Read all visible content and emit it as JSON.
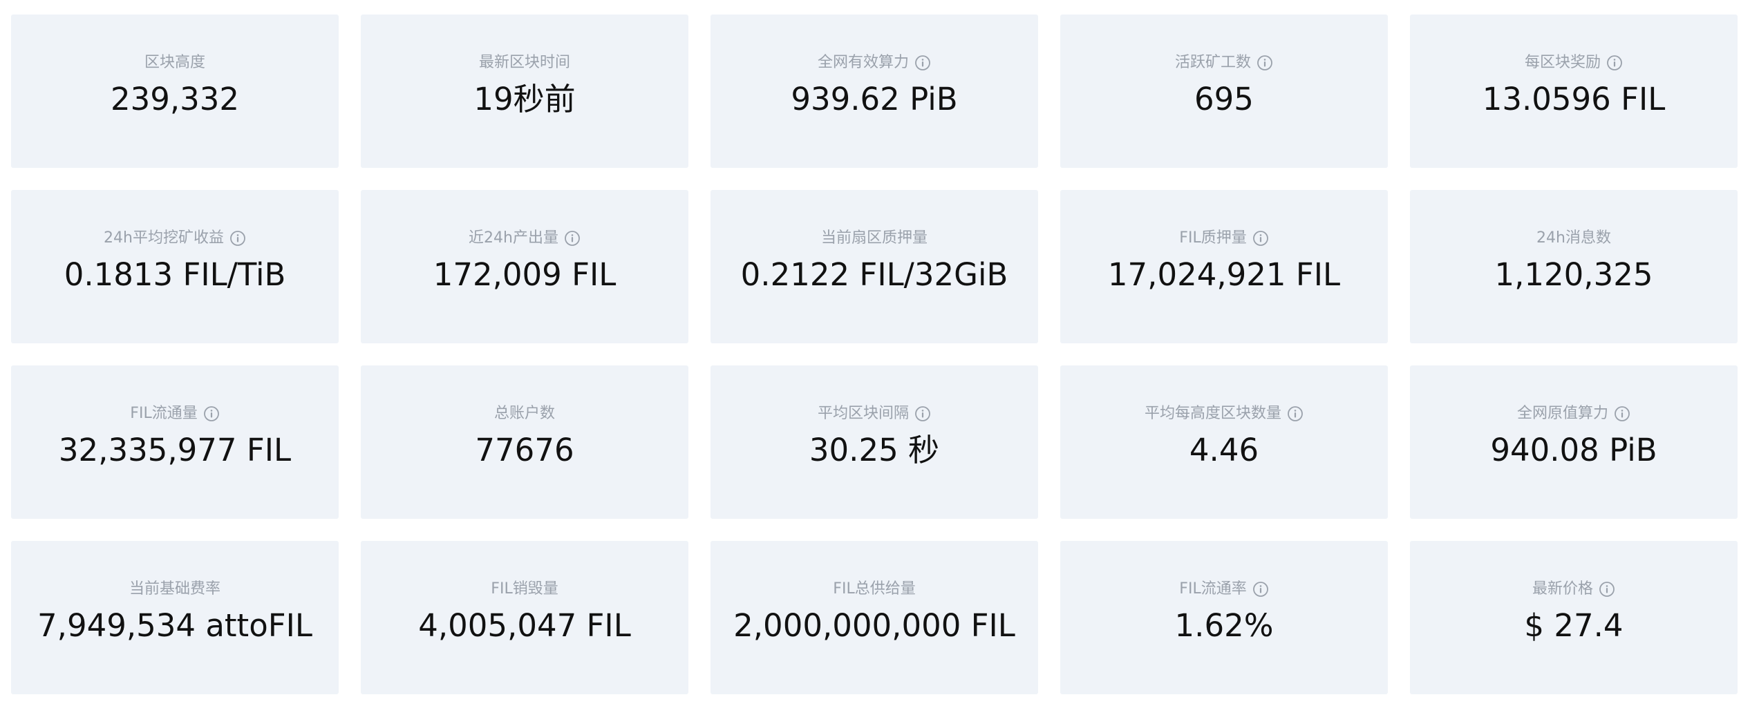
{
  "stats": [
    {
      "label": "区块高度",
      "value": "239,332",
      "info": false
    },
    {
      "label": "最新区块时间",
      "value": "19秒前",
      "info": false
    },
    {
      "label": "全网有效算力",
      "value": "939.62 PiB",
      "info": true
    },
    {
      "label": "活跃矿工数",
      "value": "695",
      "info": true
    },
    {
      "label": "每区块奖励",
      "value": "13.0596 FIL",
      "info": true
    },
    {
      "label": "24h平均挖矿收益",
      "value": "0.1813 FIL/TiB",
      "info": true
    },
    {
      "label": "近24h产出量",
      "value": "172,009 FIL",
      "info": true
    },
    {
      "label": "当前扇区质押量",
      "value": "0.2122 FIL/32GiB",
      "info": false
    },
    {
      "label": "FIL质押量",
      "value": "17,024,921 FIL",
      "info": true
    },
    {
      "label": "24h消息数",
      "value": "1,120,325",
      "info": false
    },
    {
      "label": "FIL流通量",
      "value": "32,335,977 FIL",
      "info": true
    },
    {
      "label": "总账户数",
      "value": "77676",
      "info": false
    },
    {
      "label": "平均区块间隔",
      "value": "30.25 秒",
      "info": true
    },
    {
      "label": "平均每高度区块数量",
      "value": "4.46",
      "info": true
    },
    {
      "label": "全网原值算力",
      "value": "940.08 PiB",
      "info": true
    },
    {
      "label": "当前基础费率",
      "value": "7,949,534 attoFIL",
      "info": false
    },
    {
      "label": "FIL销毁量",
      "value": "4,005,047 FIL",
      "info": false
    },
    {
      "label": "FIL总供给量",
      "value": "2,000,000,000 FIL",
      "info": false
    },
    {
      "label": "FIL流通率",
      "value": "1.62%",
      "info": true
    },
    {
      "label": "最新价格",
      "value": "$ 27.4",
      "info": true
    }
  ],
  "icons": {
    "info": "info-circle-icon"
  },
  "colors": {
    "card_background": "#eff3f8",
    "label_text": "#9aa1ab",
    "value_text": "#111111"
  }
}
